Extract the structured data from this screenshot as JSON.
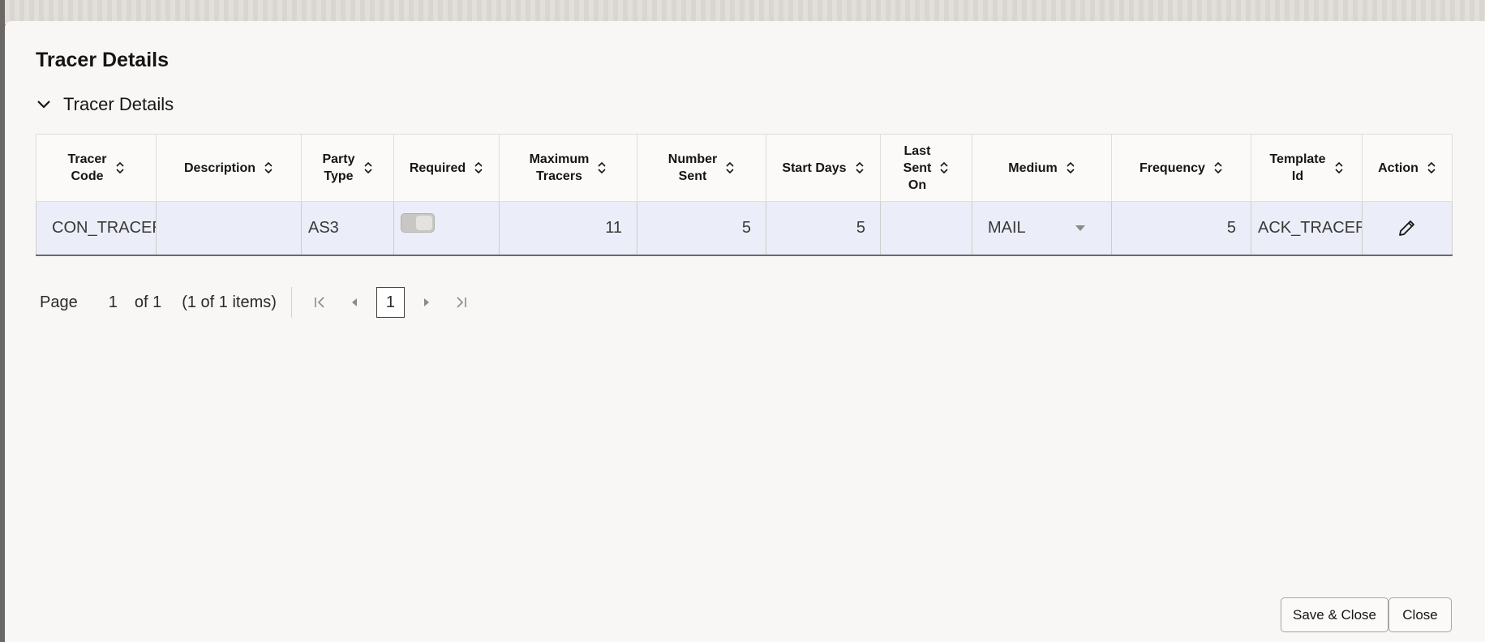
{
  "dialog": {
    "title": "Tracer Details",
    "section_title": "Tracer Details"
  },
  "table": {
    "columns": [
      {
        "key": "tracer_code",
        "label": "Tracer\nCode"
      },
      {
        "key": "description",
        "label": "Description"
      },
      {
        "key": "party_type",
        "label": "Party\nType"
      },
      {
        "key": "required",
        "label": "Required"
      },
      {
        "key": "max_tracers",
        "label": "Maximum\nTracers"
      },
      {
        "key": "number_sent",
        "label": "Number\nSent"
      },
      {
        "key": "start_days",
        "label": "Start Days"
      },
      {
        "key": "last_sent_on",
        "label": "Last\nSent\nOn"
      },
      {
        "key": "medium",
        "label": "Medium"
      },
      {
        "key": "frequency",
        "label": "Frequency"
      },
      {
        "key": "template_id",
        "label": "Template\nId"
      },
      {
        "key": "action",
        "label": "Action"
      }
    ],
    "rows": [
      {
        "tracer_code": "CON_TRACER",
        "description": "",
        "party_type": "AS3",
        "required": false,
        "max_tracers": "11",
        "number_sent": "5",
        "start_days": "5",
        "last_sent_on": "",
        "medium": "MAIL",
        "frequency": "5",
        "template_id": "ACK_TRACER"
      }
    ]
  },
  "pager": {
    "page_label": "Page",
    "page_value": "1",
    "of_label": "of 1",
    "items_label": "(1 of 1 items)",
    "current_page": "1"
  },
  "buttons": {
    "save_close": "Save & Close",
    "close": "Close"
  },
  "icons": {
    "collapse": "chevron-down-icon",
    "sort": "sort-icon",
    "edit": "pencil-icon",
    "first": "first-page-icon",
    "prev": "previous-page-icon",
    "next": "next-page-icon",
    "last": "last-page-icon"
  },
  "colors": {
    "row_bg": "#ebeef8",
    "dialog_bg": "#f8f7f5"
  }
}
